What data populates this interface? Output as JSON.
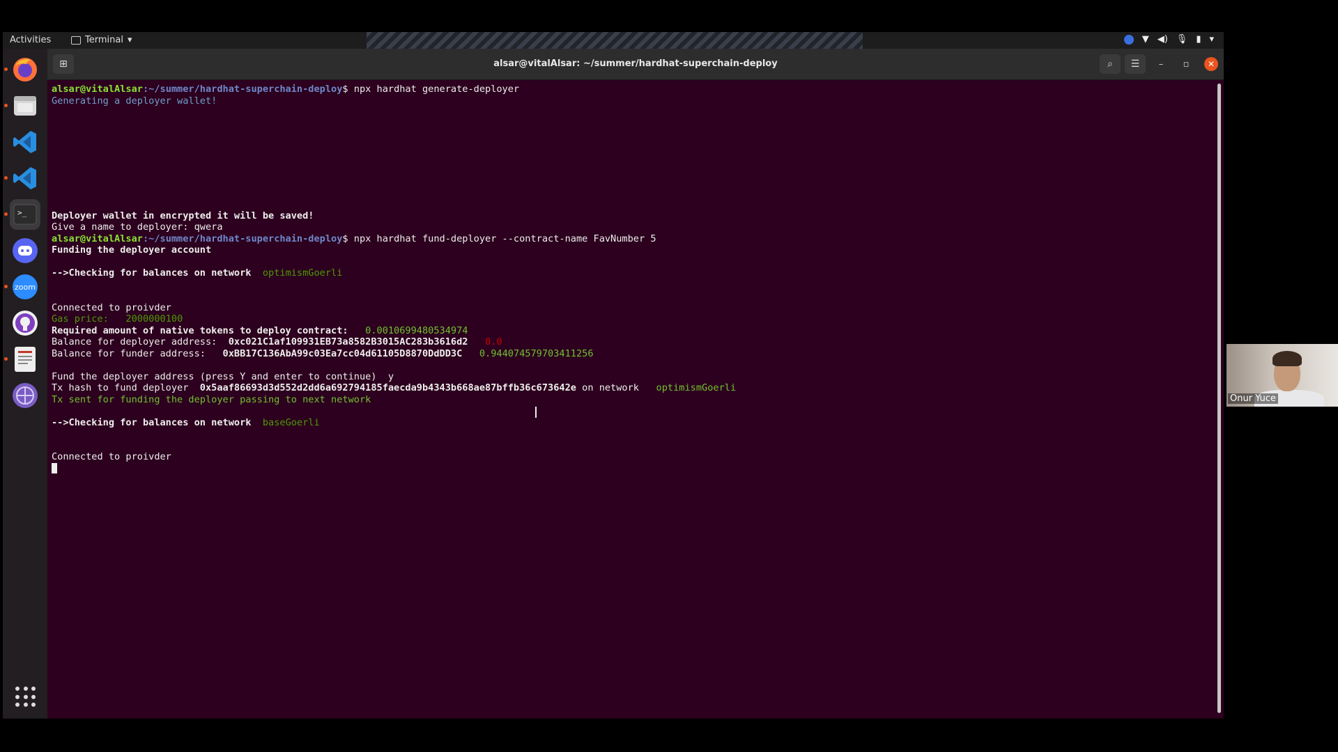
{
  "topbar": {
    "activities": "Activities",
    "app_menu": "Terminal",
    "tray": [
      "network-icon",
      "volume-icon",
      "mic-icon",
      "battery-icon",
      "menu-arrow-icon"
    ]
  },
  "dock": {
    "items": [
      "firefox-icon",
      "files-icon",
      "vscode-icon",
      "vscode-icon",
      "terminal-icon",
      "discord-icon",
      "zoom-icon",
      "github-icon",
      "document-viewer-icon",
      "network-app-icon"
    ],
    "zoom_label": "zoom",
    "apps_grid": "show-applications-icon"
  },
  "window": {
    "title": "alsar@vitalAlsar: ~/summer/hardhat-superchain-deploy"
  },
  "terminal": {
    "prompt_user": "alsar@vitalAlsar",
    "prompt_path": ":~/summer/hardhat-superchain-deploy",
    "cmd1": "$ npx hardhat generate-deployer",
    "generating": "Generating a deployer wallet!",
    "wallet_saved": "Deployer wallet in encrypted it will be saved!",
    "give_name": "Give a name to deployer: qwera",
    "cmd2": "$ npx hardhat fund-deployer --contract-name FavNumber 5",
    "funding": "Funding the deployer account",
    "checking_label": "-->Checking for balances on network",
    "network1": "optimismGoerli",
    "connected": "Connected to proivder",
    "gas_label": "Gas price:",
    "gas_value": "2000000100",
    "required_label": "Required amount of native tokens to deploy contract:",
    "required_value": "0.0010699480534974",
    "deployer_label": "Balance for deployer address:",
    "deployer_address": "0xc021C1af109931EB73a8582B3015AC283b3616d2",
    "deployer_balance": "0.0",
    "funder_label": "Balance for funder address:",
    "funder_address": "0xBB17C136AbA99c03Ea7cc04d61105D8870DdDD3C",
    "funder_balance": "0.944074579703411256",
    "fund_prompt": "Fund the deployer address (press Y and enter to continue)  y",
    "tx_label": "Tx hash to fund deployer",
    "tx_hash": "0x5aaf86693d3d552d2dd6a692794185faecda9b4343b668ae87bffb36c673642e",
    "on_network": "on network",
    "tx_sent": "Tx sent for funding the deployer passing to next network",
    "network2": "baseGoerli"
  },
  "webcam": {
    "name": "Onur Yuce"
  }
}
